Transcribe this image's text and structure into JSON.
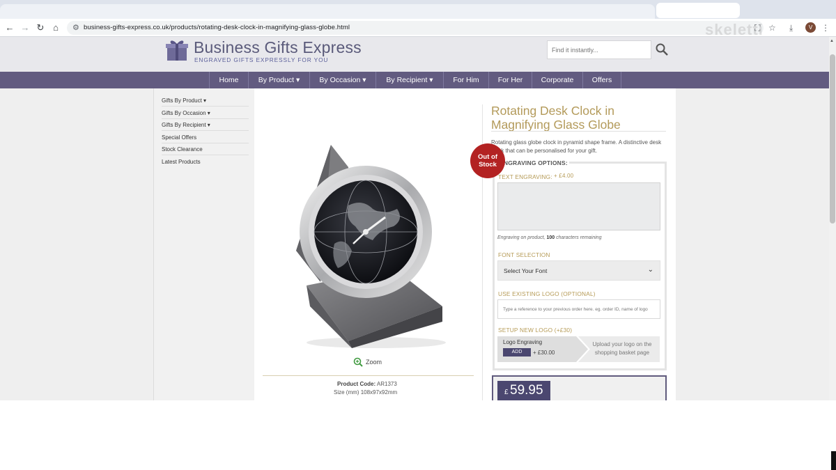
{
  "browser": {
    "url": "business-gifts-express.co.uk/products/rotating-desk-clock-in-magnifying-glass-globe.html",
    "avatar_initial": "V",
    "watermark": "skeletti"
  },
  "header": {
    "logo_name": "Business Gifts Express",
    "logo_tagline": "ENGRAVED GIFTS EXPRESSLY FOR YOU",
    "search_placeholder": "Find it instantly..."
  },
  "nav": {
    "items": [
      {
        "label": "Home"
      },
      {
        "label": "By Product ▾"
      },
      {
        "label": "By Occasion ▾"
      },
      {
        "label": "By Recipient ▾"
      },
      {
        "label": "For Him"
      },
      {
        "label": "For Her"
      },
      {
        "label": "Corporate"
      },
      {
        "label": "Offers"
      }
    ]
  },
  "sidebar": {
    "items": [
      {
        "label": "Gifts By Product ▾"
      },
      {
        "label": "Gifts By Occasion ▾"
      },
      {
        "label": "Gifts By Recipient ▾"
      },
      {
        "label": "Special Offers"
      },
      {
        "label": "Stock Clearance"
      },
      {
        "label": "Latest Products"
      }
    ]
  },
  "product": {
    "title": "Rotating Desk Clock in Magnifying Glass Globe",
    "description": "Rotating glass globe clock in pyramid shape frame. A distinctive desk clock that can be personalised for your gift.",
    "zoom_label": "Zoom",
    "code_label": "Product Code:",
    "code_value": "AR1373",
    "size_label": "Size (mm)",
    "size_value": "108x97x92mm",
    "stock_badge_line1": "Out of",
    "stock_badge_line2": "Stock"
  },
  "engraving": {
    "heading": "ENGRAVING OPTIONS:",
    "text_label": "TEXT ENGRAVING:",
    "text_price": "+ £4.00",
    "help_prefix": "Engraving on product,",
    "help_count": "100",
    "help_suffix": "characters remaining",
    "font_label": "FONT SELECTION",
    "font_value": "Select Your Font",
    "existing_logo_label": "USE EXISTING LOGO (OPTIONAL)",
    "existing_logo_placeholder": "Type a reference to your previous order here. eg. order ID, name of logo",
    "new_logo_label": "SETUP NEW LOGO (+£30)",
    "step1_title": "Logo Engraving",
    "add_button": "ADD",
    "step1_price": "+ £30.00",
    "step2_text": "Upload your logo on the shopping basket page"
  },
  "price": {
    "currency": "£",
    "value": "59.95"
  }
}
